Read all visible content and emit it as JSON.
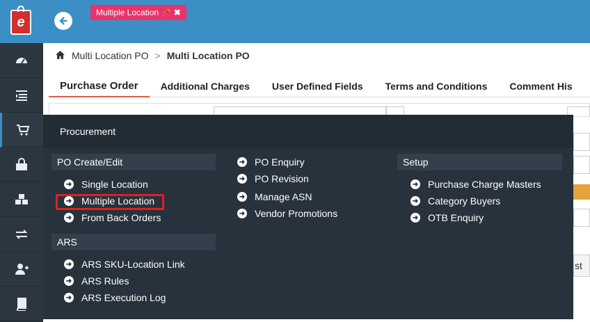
{
  "tag": {
    "label": "Multiple Location",
    "pin_icon": "pin-icon",
    "close_icon": "close-icon"
  },
  "breadcrumb": {
    "parent": "Multi Location PO",
    "separator": ">",
    "current": "Multi Location PO"
  },
  "tabs": [
    {
      "label": "Purchase Order"
    },
    {
      "label": "Additional Charges"
    },
    {
      "label": "User Defined Fields"
    },
    {
      "label": "Terms and Conditions"
    },
    {
      "label": "Comment His"
    }
  ],
  "menu": {
    "title": "Procurement",
    "po_create": {
      "header": "PO Create/Edit",
      "items": [
        "Single Location",
        "Multiple Location",
        "From Back Orders"
      ]
    },
    "ars": {
      "header": "ARS",
      "items": [
        "ARS SKU-Location Link",
        "ARS Rules",
        "ARS Execution Log"
      ]
    },
    "column2": {
      "items": [
        "PO Enquiry",
        "PO Revision",
        "Manage ASN",
        "Vendor Promotions"
      ]
    },
    "setup": {
      "header": "Setup",
      "items": [
        "Purchase Charge Masters",
        "Category Buyers",
        "OTB Enquiry"
      ]
    }
  },
  "background": {
    "partial_text": "st"
  },
  "colors": {
    "topbar": "#3b8fc4",
    "sidebar": "#2b3641",
    "menu": "#27323c",
    "tag": "#e8336d",
    "highlight": "#e02020"
  }
}
